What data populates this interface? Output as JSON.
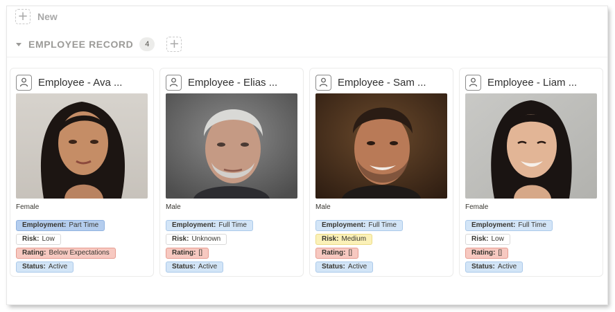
{
  "toolbar": {
    "new_label": "New"
  },
  "group": {
    "title": "EMPLOYEE RECORD",
    "count": "4"
  },
  "colors": {
    "employment_tag": "#d3e5f7",
    "risk_tag": "#ffffff",
    "rating_tag": "#f7c9c1",
    "medium_risk_tag": "#fbf1b8"
  },
  "cards": [
    {
      "title": "Employee - Ava ...",
      "gender": "Female",
      "employment": {
        "key": "Employment:",
        "value": "Part Time"
      },
      "risk": {
        "key": "Risk:",
        "value": "Low"
      },
      "rating": {
        "key": "Rating:",
        "value": "Below Expectations"
      },
      "status": {
        "key": "Status:",
        "value": "Active"
      }
    },
    {
      "title": "Employee - Elias ...",
      "gender": "Male",
      "employment": {
        "key": "Employment:",
        "value": "Full Time"
      },
      "risk": {
        "key": "Risk:",
        "value": "Unknown"
      },
      "rating": {
        "key": "Rating:",
        "value": "[]"
      },
      "status": {
        "key": "Status:",
        "value": "Active"
      }
    },
    {
      "title": "Employee - Sam ...",
      "gender": "Male",
      "employment": {
        "key": "Employment:",
        "value": "Full Time"
      },
      "risk": {
        "key": "Risk:",
        "value": "Medium"
      },
      "rating": {
        "key": "Rating:",
        "value": "[]"
      },
      "status": {
        "key": "Status:",
        "value": "Active"
      }
    },
    {
      "title": "Employee - Liam ...",
      "gender": "Female",
      "employment": {
        "key": "Employment:",
        "value": "Full Time"
      },
      "risk": {
        "key": "Risk:",
        "value": "Low"
      },
      "rating": {
        "key": "Rating:",
        "value": "[]"
      },
      "status": {
        "key": "Status:",
        "value": "Active"
      }
    }
  ]
}
